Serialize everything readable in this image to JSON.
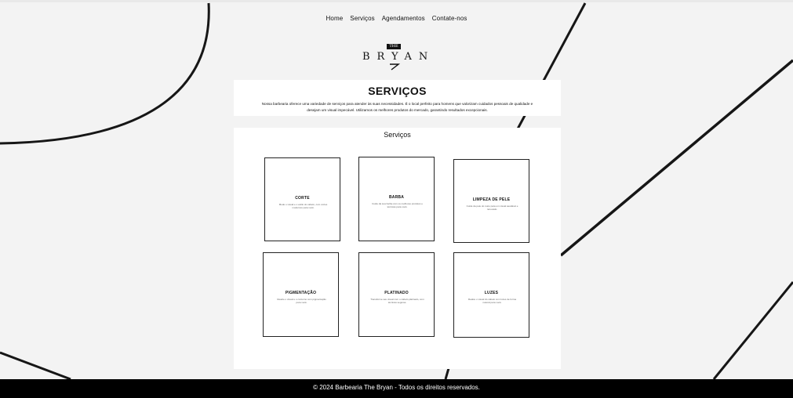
{
  "nav": {
    "items": [
      "Home",
      "Serviços",
      "Agendamentos",
      "Contate-nos"
    ]
  },
  "logo": {
    "small": "THE",
    "name": "BRYAN"
  },
  "intro": {
    "title": "SERVIÇOS",
    "text": "Nossa barbearia oferece uma variedade de serviços para atender às suas necessidades. É o local perfeito para homens que valorizam cuidados pessoais de qualidade e desejam um visual impecável. Utilizamos os melhores produtos do mercado, garantindo resultados excepcionais."
  },
  "services": {
    "title": "Serviços",
    "cards": [
      {
        "name": "CORTE",
        "desc": "Mude o visual e o estilo do cabelo, com cortes modernos para você."
      },
      {
        "name": "BARBA",
        "desc": "Cuide da sua barba com os melhores produtos e técnicas para você."
      },
      {
        "name": "LIMPEZA DE PELE",
        "desc": "Cuide da pele do rosto para um visual saudável e renovado."
      },
      {
        "name": "PIGMENTAÇÃO",
        "desc": "Realce o visual e o contorno com pigmentação para você."
      },
      {
        "name": "PLATINADO",
        "desc": "Transforme seu visual com o cabelo platinado, com técnicas seguras."
      },
      {
        "name": "LUZES",
        "desc": "Realce o visual do cabelo com luzes de forma natural para você."
      }
    ]
  },
  "footer": {
    "text": "© 2024 Barbearia The Bryan - Todos os direitos reservados."
  },
  "colors": {
    "background": "#f3f3f3",
    "panel": "#ffffff",
    "text": "#111111",
    "footer": "#000000",
    "lines": "#111111"
  }
}
